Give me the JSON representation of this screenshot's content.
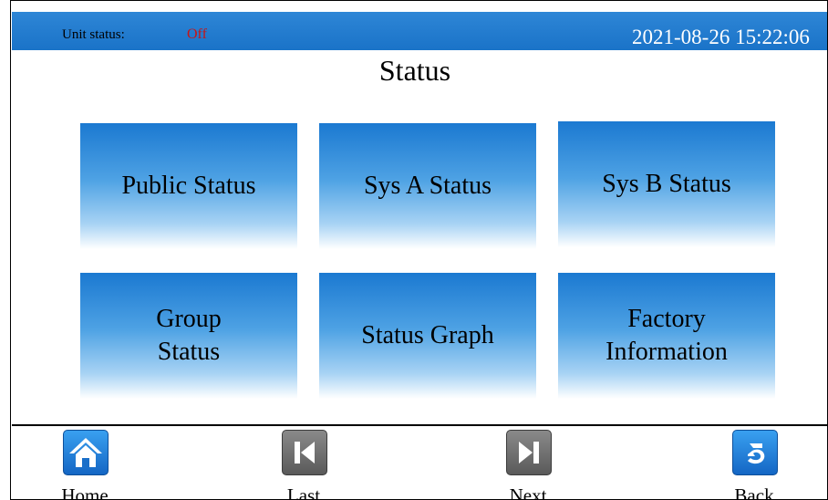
{
  "header": {
    "unit_status_label": "Unit status:",
    "unit_status_value": "Off",
    "datetime": "2021-08-26  15:22:06"
  },
  "page": {
    "title": "Status"
  },
  "tiles": [
    {
      "lines": [
        "Public Status"
      ]
    },
    {
      "lines": [
        "Sys A Status"
      ]
    },
    {
      "lines": [
        "Sys B Status"
      ]
    },
    {
      "lines": [
        "Group",
        "Status"
      ]
    },
    {
      "lines": [
        "Status Graph"
      ]
    },
    {
      "lines": [
        "Factory",
        "Information"
      ]
    }
  ],
  "nav": {
    "home": {
      "label": "Home",
      "icon": "home-icon"
    },
    "last": {
      "label": "Last",
      "icon": "first-page-icon"
    },
    "next": {
      "label": "Next",
      "icon": "last-page-icon"
    },
    "back": {
      "label": "Back",
      "icon": "back-arrow-icon"
    }
  },
  "colors": {
    "header_bar": "#1a73c8",
    "status_off": "#c81414",
    "tile_top": "#1b79d1",
    "nav_blue": "#1466c4",
    "nav_gray": "#5a5a5a"
  }
}
